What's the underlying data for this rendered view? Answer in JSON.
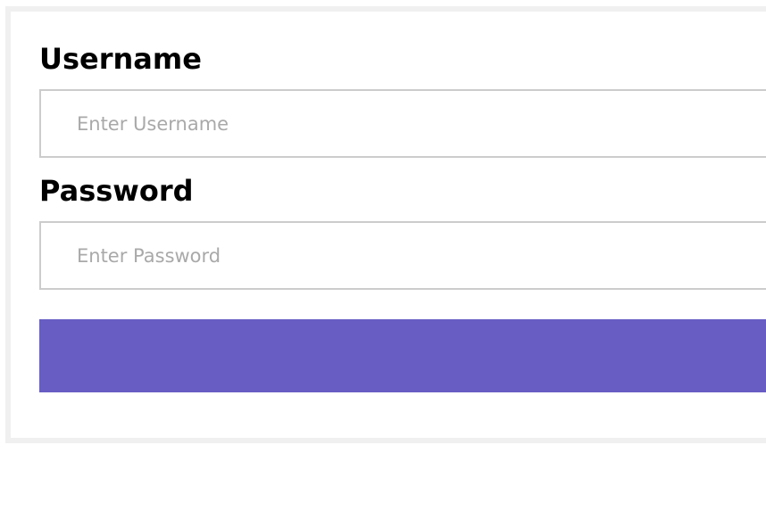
{
  "form": {
    "username": {
      "label": "Username",
      "value": "",
      "placeholder": "Enter Username"
    },
    "password": {
      "label": "Password",
      "value": "",
      "placeholder": "Enter Password"
    },
    "submit": {
      "label": "",
      "color": "#675dc3"
    }
  },
  "colors": {
    "card_border": "#f0f0f0",
    "input_border": "#cccccc",
    "placeholder": "#a9a9a9",
    "accent": "#675dc3"
  }
}
